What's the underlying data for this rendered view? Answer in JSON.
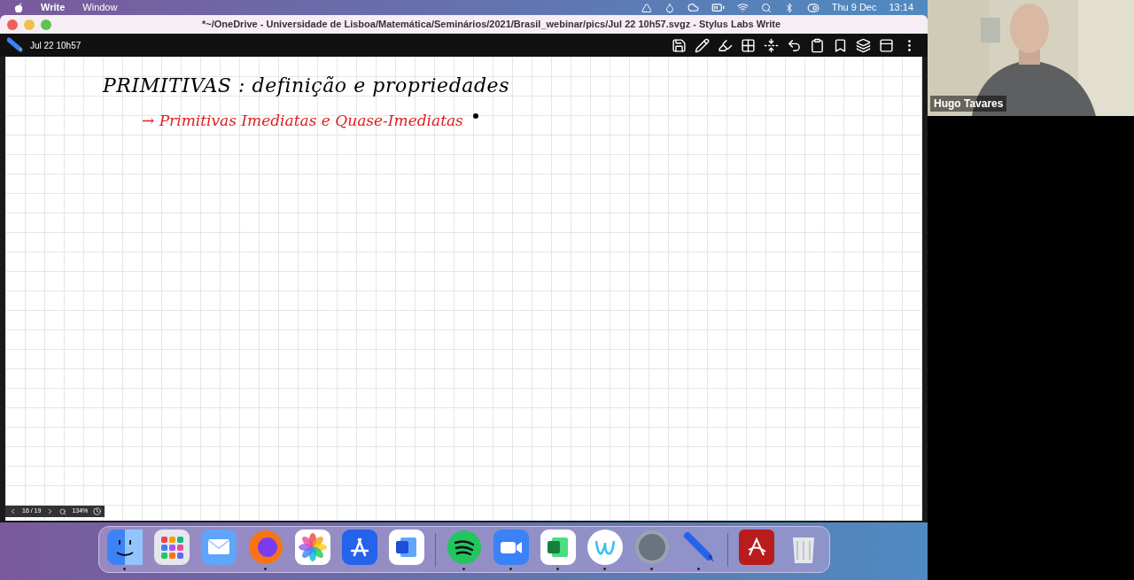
{
  "menu_bar": {
    "app_name": "Write",
    "menus": [
      "Window"
    ],
    "date": "Thu 9 Dec",
    "time": "13:14"
  },
  "window": {
    "title": "*~/OneDrive - Universidade de Lisboa/Matemática/Seminários/2021/Brasil_webinar/pics/Jul 22 10h57.svgz - Stylus Labs Write"
  },
  "toolbar": {
    "document": "Jul 22 10h57"
  },
  "canvas": {
    "lines": [
      {
        "kind": "heading",
        "text": "PRIMITIVAS : definição e propriedades"
      },
      {
        "kind": "bullet",
        "text": "→ Primitivas Imediatas e Quase-Imediatas"
      }
    ]
  },
  "page_nav": {
    "page": "16 / 19",
    "zoom": "134%"
  },
  "dock": {
    "sections": [
      {
        "apps": [
          {
            "kind": "finder",
            "running": true
          },
          {
            "kind": "launchpad",
            "running": false
          },
          {
            "kind": "mail",
            "running": false
          },
          {
            "kind": "firefox",
            "running": true
          },
          {
            "kind": "photos",
            "running": false
          },
          {
            "kind": "appstore",
            "running": false
          },
          {
            "kind": "word",
            "running": false
          }
        ]
      },
      {
        "apps": [
          {
            "kind": "spotify",
            "running": true
          },
          {
            "kind": "zoom",
            "running": true
          },
          {
            "kind": "excel",
            "running": true
          },
          {
            "kind": "writer",
            "running": true
          },
          {
            "kind": "tex",
            "running": true
          },
          {
            "kind": "pencil",
            "running": true
          }
        ]
      },
      {
        "apps": [
          {
            "kind": "acrobat",
            "running": false
          },
          {
            "kind": "trash",
            "running": false
          }
        ]
      }
    ]
  },
  "video": {
    "name": "Hugo Tavares"
  }
}
